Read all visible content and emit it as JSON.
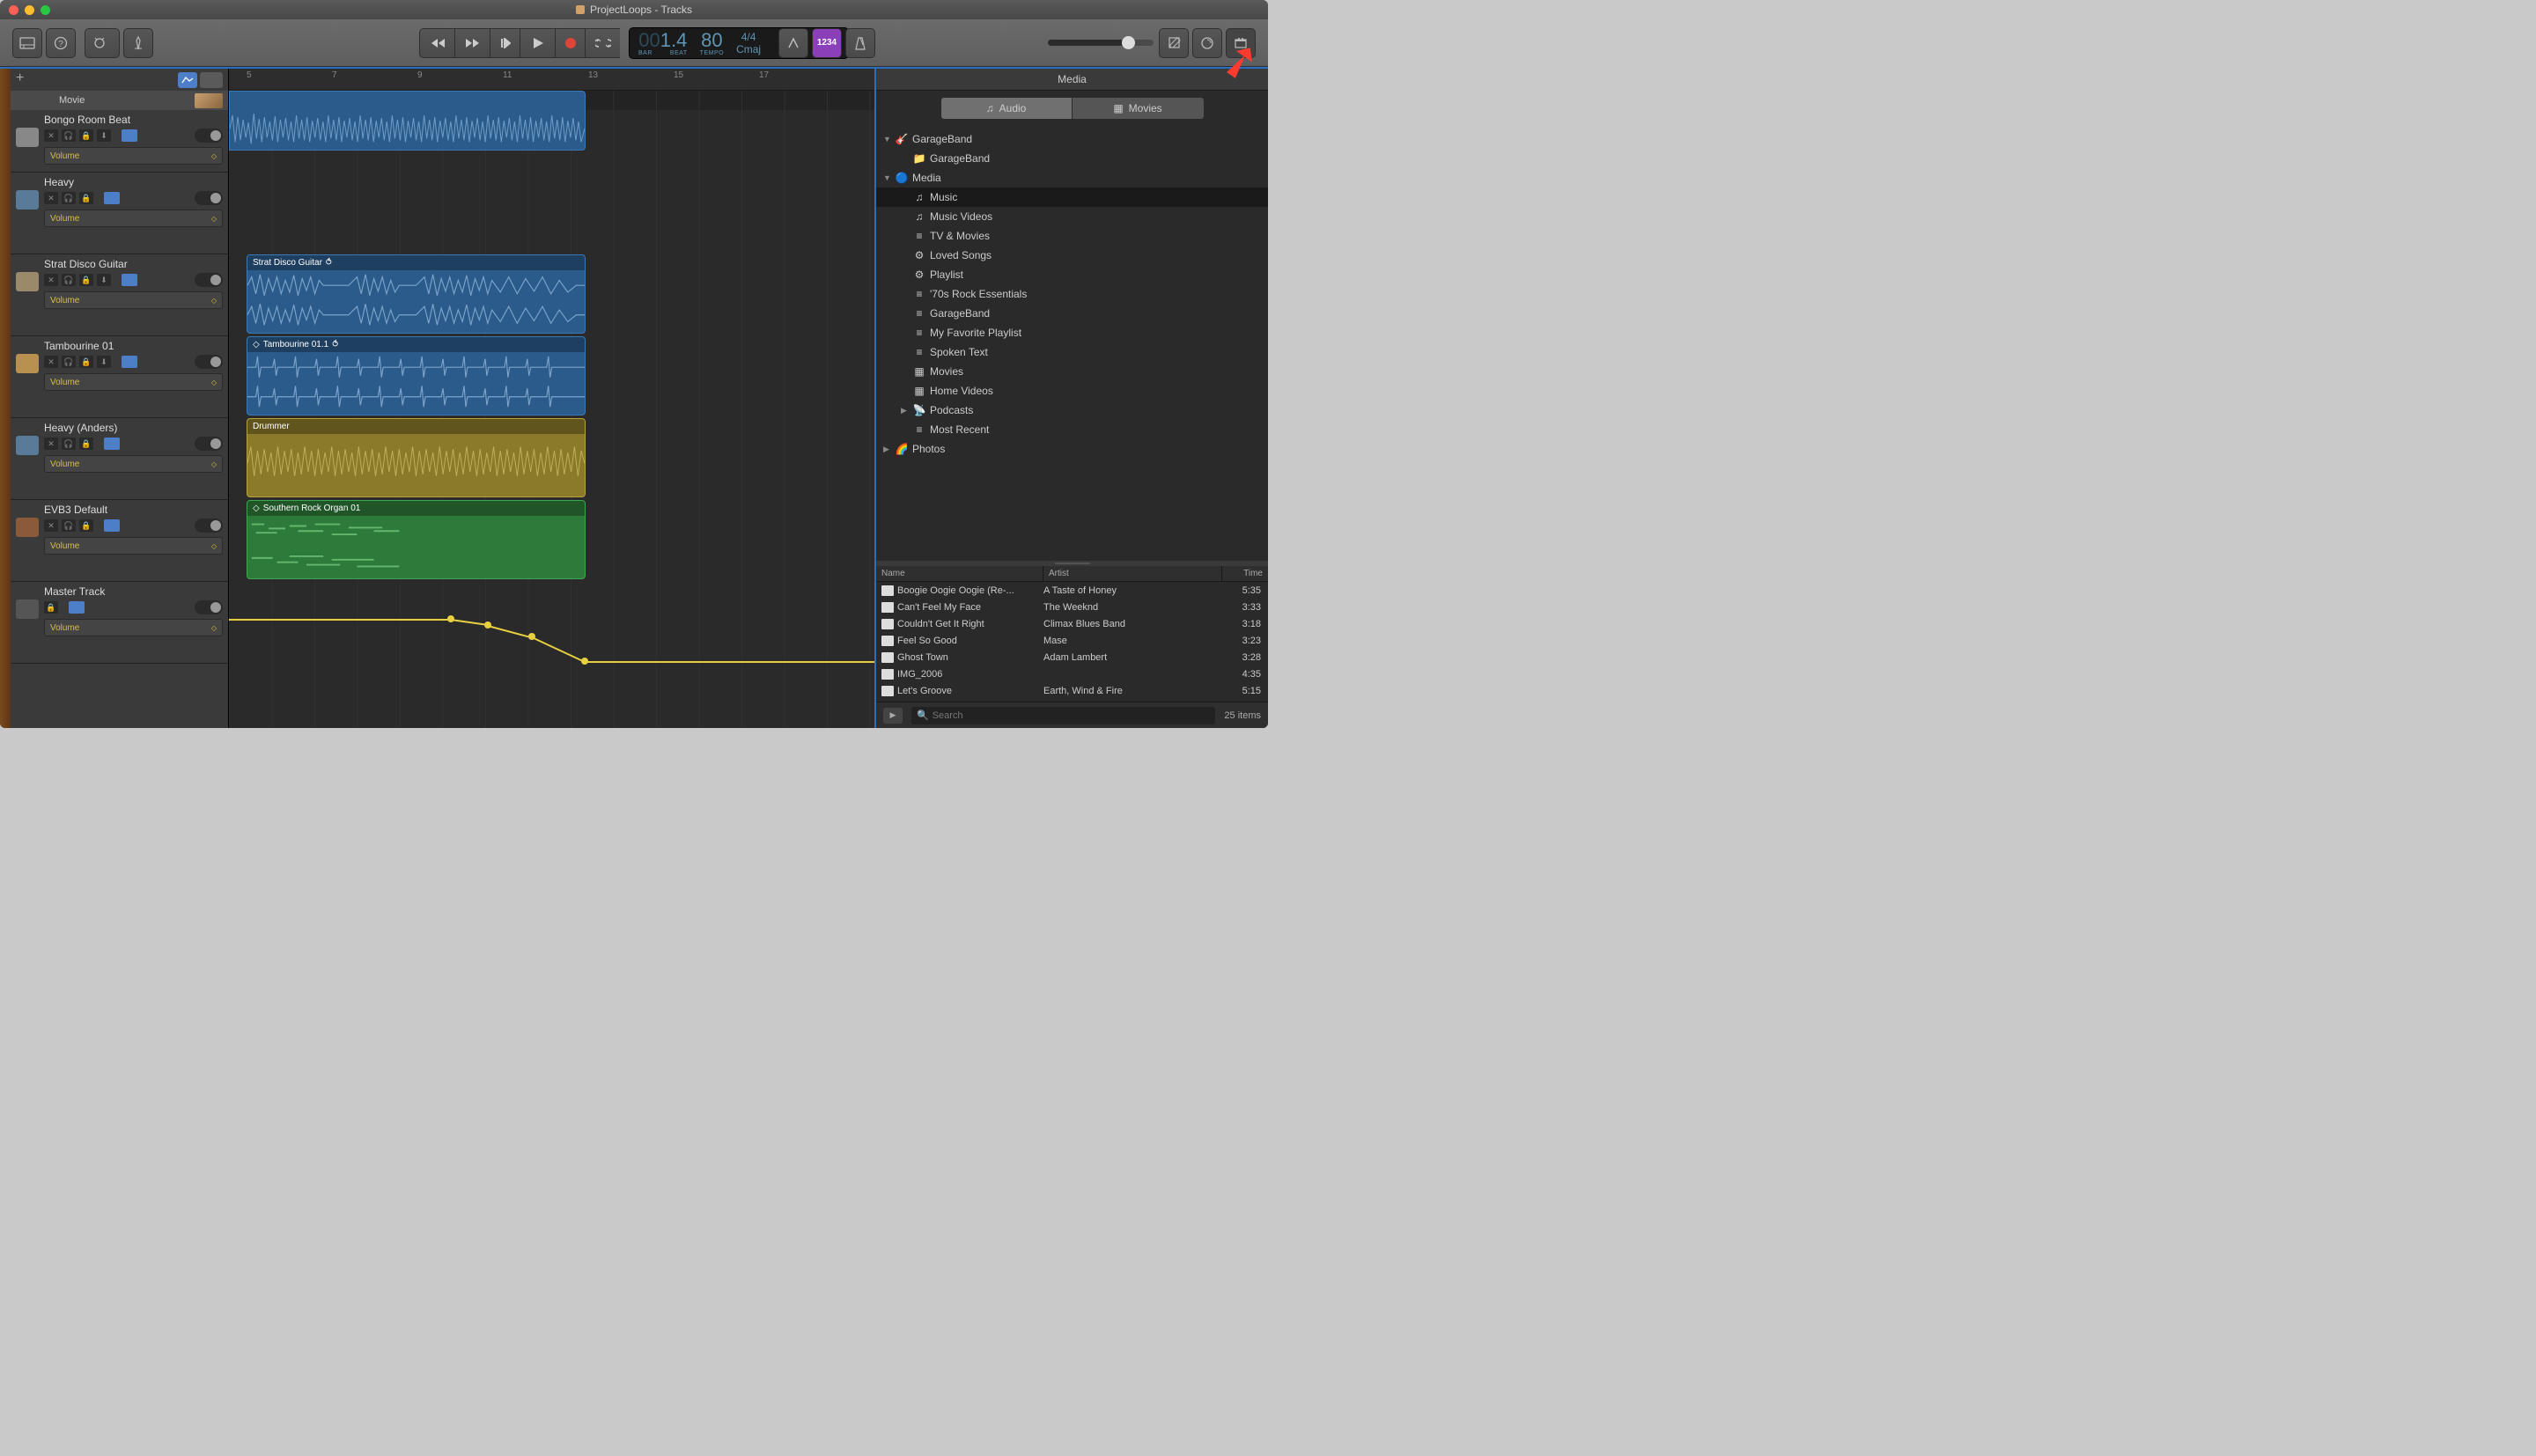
{
  "window": {
    "title": "ProjectLoops - Tracks"
  },
  "lcd": {
    "bar": "1",
    "barDim": "00",
    "beat": "4",
    "tempo": "80",
    "sig": "4/4",
    "key": "Cmaj",
    "sub_bar": "BAR",
    "sub_beat": "BEAT",
    "sub_tempo": "TEMPO"
  },
  "toolbar": {
    "steps": "1234"
  },
  "ruler": {
    "ticks": [
      "5",
      "7",
      "9",
      "11",
      "13",
      "15",
      "17"
    ]
  },
  "sidebar": {
    "movie": "Movie",
    "tracks": [
      {
        "name": "Bongo Room Beat",
        "volume": "Volume"
      },
      {
        "name": "Heavy",
        "volume": "Volume"
      },
      {
        "name": "Strat Disco Guitar",
        "volume": "Volume"
      },
      {
        "name": "Tambourine 01",
        "volume": "Volume"
      },
      {
        "name": "Heavy (Anders)",
        "volume": "Volume"
      },
      {
        "name": "EVB3 Default",
        "volume": "Volume"
      },
      {
        "name": "Master Track",
        "volume": "Volume"
      }
    ]
  },
  "regions": [
    {
      "name": "",
      "color": "blue"
    },
    {
      "name": "Strat Disco Guitar",
      "color": "blue",
      "loop": true
    },
    {
      "name": "Tambourine 01.1",
      "color": "blue",
      "loop": true
    },
    {
      "name": "Drummer",
      "color": "yellow"
    },
    {
      "name": "Southern Rock Organ 01",
      "color": "green",
      "loop": true
    }
  ],
  "media": {
    "title": "Media",
    "tabs": [
      {
        "label": "Audio"
      },
      {
        "label": "Movies"
      }
    ],
    "tree": [
      {
        "label": "GarageBand",
        "level": 0,
        "disc": "down",
        "icon": "gb"
      },
      {
        "label": "GarageBand",
        "level": 1,
        "icon": "folder"
      },
      {
        "label": "Media",
        "level": 0,
        "disc": "down",
        "icon": "itunes"
      },
      {
        "label": "Music",
        "level": 1,
        "icon": "note",
        "sel": true
      },
      {
        "label": "Music Videos",
        "level": 1,
        "icon": "note"
      },
      {
        "label": "TV & Movies",
        "level": 1,
        "icon": "list"
      },
      {
        "label": "Loved Songs",
        "level": 1,
        "icon": "gear"
      },
      {
        "label": "Playlist",
        "level": 1,
        "icon": "gear"
      },
      {
        "label": "'70s Rock Essentials",
        "level": 1,
        "icon": "list"
      },
      {
        "label": "GarageBand",
        "level": 1,
        "icon": "list"
      },
      {
        "label": "My Favorite Playlist",
        "level": 1,
        "icon": "list"
      },
      {
        "label": "Spoken Text",
        "level": 1,
        "icon": "list"
      },
      {
        "label": "Movies",
        "level": 1,
        "icon": "film"
      },
      {
        "label": "Home Videos",
        "level": 1,
        "icon": "film"
      },
      {
        "label": "Podcasts",
        "level": 1,
        "disc": "right",
        "icon": "podcast"
      },
      {
        "label": "Most Recent",
        "level": 1,
        "icon": "list"
      },
      {
        "label": "Photos",
        "level": 0,
        "disc": "right",
        "icon": "photos"
      }
    ],
    "columns": {
      "name": "Name",
      "artist": "Artist",
      "time": "Time"
    },
    "rows": [
      {
        "name": "Boogie Oogie Oogie (Re-...",
        "artist": "A Taste of Honey",
        "time": "5:35"
      },
      {
        "name": "Can't Feel My Face",
        "artist": "The Weeknd",
        "time": "3:33"
      },
      {
        "name": "Couldn't Get It Right",
        "artist": "Climax Blues Band",
        "time": "3:18"
      },
      {
        "name": "Feel So Good",
        "artist": "Mase",
        "time": "3:23"
      },
      {
        "name": "Ghost Town",
        "artist": "Adam Lambert",
        "time": "3:28"
      },
      {
        "name": "IMG_2006",
        "artist": "",
        "time": "4:35"
      },
      {
        "name": "Let's Groove",
        "artist": "Earth, Wind & Fire",
        "time": "5:15"
      }
    ],
    "search": {
      "placeholder": "Search"
    },
    "footer": {
      "count": "25 items"
    }
  }
}
